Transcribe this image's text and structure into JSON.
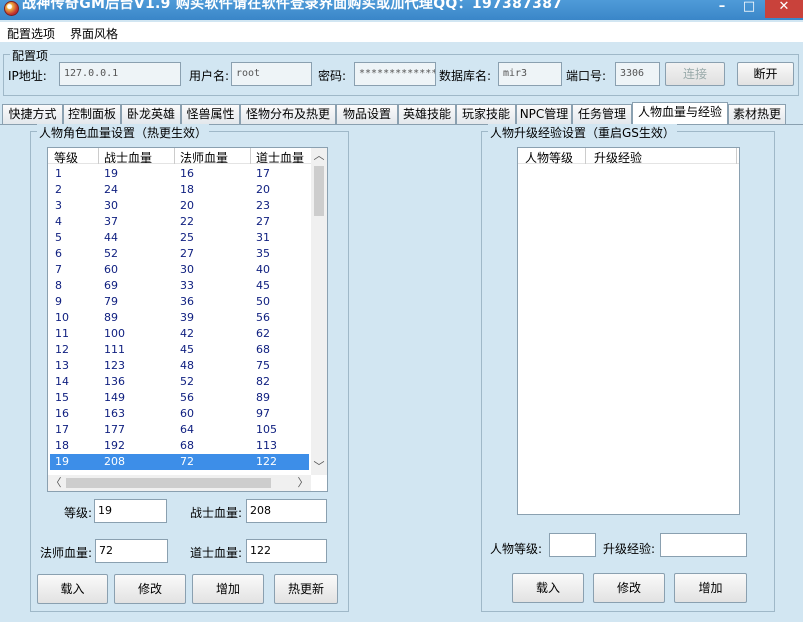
{
  "window": {
    "title": "战神传奇GM后台V1.9   购买软件请在软件登录界面购买或加代理QQ：197387387",
    "min_glyph": "–",
    "max_glyph": "□",
    "close_glyph": "✕"
  },
  "menu": [
    "配置选项",
    "界面风格"
  ],
  "config": {
    "legend": "配置项",
    "ip_label": "IP地址:",
    "ip_value": "127.0.0.1",
    "user_label": "用户名:",
    "user_value": "root",
    "pwd_label": "密码:",
    "pwd_value": "*************",
    "db_label": "数据库名:",
    "db_value": "mir3",
    "port_label": "端口号:",
    "port_value": "3306",
    "connect_label": "连接",
    "disconnect_label": "断开"
  },
  "tabs": [
    "快捷方式",
    "控制面板",
    "卧龙英雄",
    "怪兽属性",
    "怪物分布及热更",
    "物品设置",
    "英雄技能",
    "玩家技能",
    "NPC管理",
    "任务管理",
    "人物血量与经验",
    "素材热更"
  ],
  "active_tab": 10,
  "hp_panel": {
    "legend": "人物角色血量设置（热更生效）",
    "columns": [
      "等级",
      "战士血量",
      "法师血量",
      "道士血量"
    ],
    "rows": [
      [
        "1",
        "19",
        "16",
        "17"
      ],
      [
        "2",
        "24",
        "18",
        "20"
      ],
      [
        "3",
        "30",
        "20",
        "23"
      ],
      [
        "4",
        "37",
        "22",
        "27"
      ],
      [
        "5",
        "44",
        "25",
        "31"
      ],
      [
        "6",
        "52",
        "27",
        "35"
      ],
      [
        "7",
        "60",
        "30",
        "40"
      ],
      [
        "8",
        "69",
        "33",
        "45"
      ],
      [
        "9",
        "79",
        "36",
        "50"
      ],
      [
        "10",
        "89",
        "39",
        "56"
      ],
      [
        "11",
        "100",
        "42",
        "62"
      ],
      [
        "12",
        "111",
        "45",
        "68"
      ],
      [
        "13",
        "123",
        "48",
        "75"
      ],
      [
        "14",
        "136",
        "52",
        "82"
      ],
      [
        "15",
        "149",
        "56",
        "89"
      ],
      [
        "16",
        "163",
        "60",
        "97"
      ],
      [
        "17",
        "177",
        "64",
        "105"
      ],
      [
        "18",
        "192",
        "68",
        "113"
      ],
      [
        "19",
        "208",
        "72",
        "122"
      ]
    ],
    "selected_row": 18,
    "scroll_up_glyph": "︿",
    "scroll_down_glyph": "﹀",
    "scroll_left_glyph": "〈",
    "scroll_right_glyph": "〉",
    "level_label": "等级:",
    "level_value": "19",
    "warrior_label": "战士血量:",
    "warrior_value": "208",
    "mage_label": "法师血量:",
    "mage_value": "72",
    "taoist_label": "道士血量:",
    "taoist_value": "122",
    "btn_load": "载入",
    "btn_modify": "修改",
    "btn_add": "增加",
    "btn_hot": "热更新"
  },
  "exp_panel": {
    "legend": "人物升级经验设置（重启GS生效）",
    "columns": [
      "人物等级",
      "升级经验"
    ],
    "level_label": "人物等级:",
    "level_value": "",
    "exp_label": "升级经验:",
    "exp_value": "",
    "btn_load": "载入",
    "btn_modify": "修改",
    "btn_add": "增加"
  }
}
